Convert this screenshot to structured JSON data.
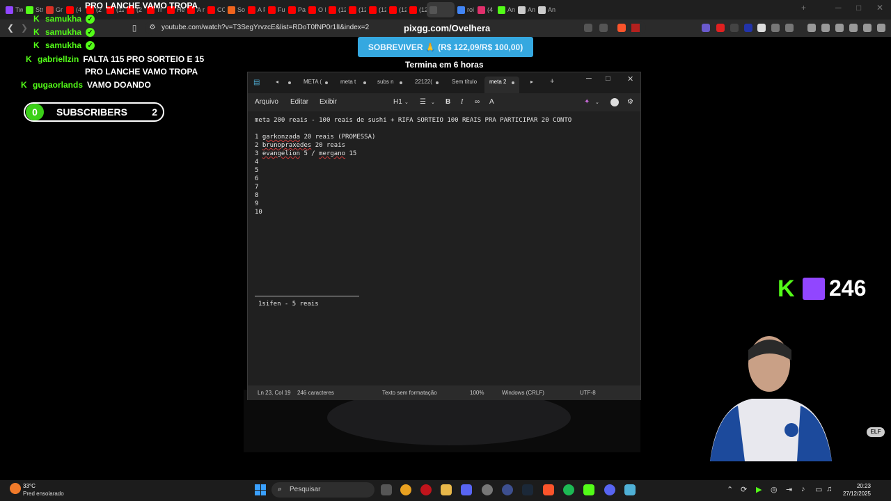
{
  "browser": {
    "tabs": [
      {
        "label": "Tw",
        "color": "#9146ff"
      },
      {
        "label": "Str",
        "color": "#53fc18"
      },
      {
        "label": "Gr",
        "color": "#d93025"
      },
      {
        "label": "(4",
        "color": "#ff0000"
      },
      {
        "label": "(2",
        "color": "#ff0000"
      },
      {
        "label": "(12",
        "color": "#ff0000"
      },
      {
        "label": "(2",
        "color": "#ff0000"
      },
      {
        "label": "Tr",
        "color": "#ff0000"
      },
      {
        "label": "He",
        "color": "#ff0000"
      },
      {
        "label": "A r",
        "color": "#ff0000"
      },
      {
        "label": "CC",
        "color": "#ff0000"
      },
      {
        "label": "So",
        "color": "#f0641e"
      },
      {
        "label": "A F",
        "color": "#ff0000"
      },
      {
        "label": "Fu",
        "color": "#ff0000"
      },
      {
        "label": "Pa",
        "color": "#ff0000"
      },
      {
        "label": "O I",
        "color": "#ff0000"
      },
      {
        "label": "(12",
        "color": "#ff0000"
      },
      {
        "label": "(12",
        "color": "#ff0000"
      },
      {
        "label": "(12",
        "color": "#ff0000"
      },
      {
        "label": "(12",
        "color": "#ff0000"
      },
      {
        "label": "(12",
        "color": "#ff0000"
      },
      {
        "label": "",
        "color": "#555555"
      },
      {
        "label": "roi",
        "color": "#4285f4"
      },
      {
        "label": "(4",
        "color": "#e1306c"
      },
      {
        "label": "An",
        "color": "#53fc18"
      },
      {
        "label": "An",
        "color": "#cccccc"
      },
      {
        "label": "An",
        "color": "#cccccc"
      }
    ],
    "url": "youtube.com/watch?v=T3SegYrvzcE&list=RDoT0fNP0r1lI&index=2"
  },
  "overlay": {
    "chat": [
      {
        "user": "",
        "message": "PRO LANCHE VAMO TROPA"
      },
      {
        "user": "samukha",
        "message": ""
      },
      {
        "user": "samukha",
        "message": ""
      },
      {
        "user": "samukha",
        "message": ""
      },
      {
        "user": "gabriellzin",
        "message": "FALTA 115 PRO SORTEIO E 15"
      },
      {
        "user": "",
        "message": "PRO LANCHE VAMO TROPA"
      },
      {
        "user": "gugaorlands",
        "message": "VAMO DOANDO"
      }
    ],
    "subscribers": {
      "count": "0",
      "label": "SUBSCRIBERS",
      "target": "2"
    },
    "pix": "pixgg.com/Ovelhera",
    "goal": "SOBREVIVER 🙏 (R$ 122,09/R$ 100,00)",
    "timer": "Termina em 6 horas",
    "viewers": "246",
    "elf": "ELF"
  },
  "notepad": {
    "tabs": [
      "META (",
      "meta t",
      "subs n",
      "22122(",
      "Sem título",
      "meta 2"
    ],
    "menu": [
      "Arquivo",
      "Editar",
      "Exibir"
    ],
    "heading_select": "H1",
    "title_line": "meta 200 reais - 100 reais de sushi + RIFA SORTEIO 100 REAIS PRA PARTICIPAR 20 CONTO",
    "entries": [
      {
        "n": "1",
        "name": "garkonzada",
        "rest": " 20 reais (PROMESSA)"
      },
      {
        "n": "2",
        "name": "brunopraxedes",
        "rest": " 20 reais"
      },
      {
        "n": "3",
        "name": "evangelion",
        "rest": " 5 / ",
        "name2": "mergano",
        "rest2": " 15"
      }
    ],
    "empty_numbers": [
      "4",
      "5",
      "6",
      "7",
      "8",
      "9",
      "10"
    ],
    "footer_line": "1sifen - 5 reais",
    "status": {
      "position": "Ln 23, Col 19",
      "chars": "246 caracteres",
      "format": "Texto sem formatação",
      "zoom": "100%",
      "eol": "Windows (CRLF)",
      "encoding": "UTF-8"
    }
  },
  "taskbar": {
    "temp": "33°C",
    "weather": "Pred ensolarado",
    "search_placeholder": "Pesquisar",
    "time": "20:23",
    "date": "27/12/2025"
  }
}
